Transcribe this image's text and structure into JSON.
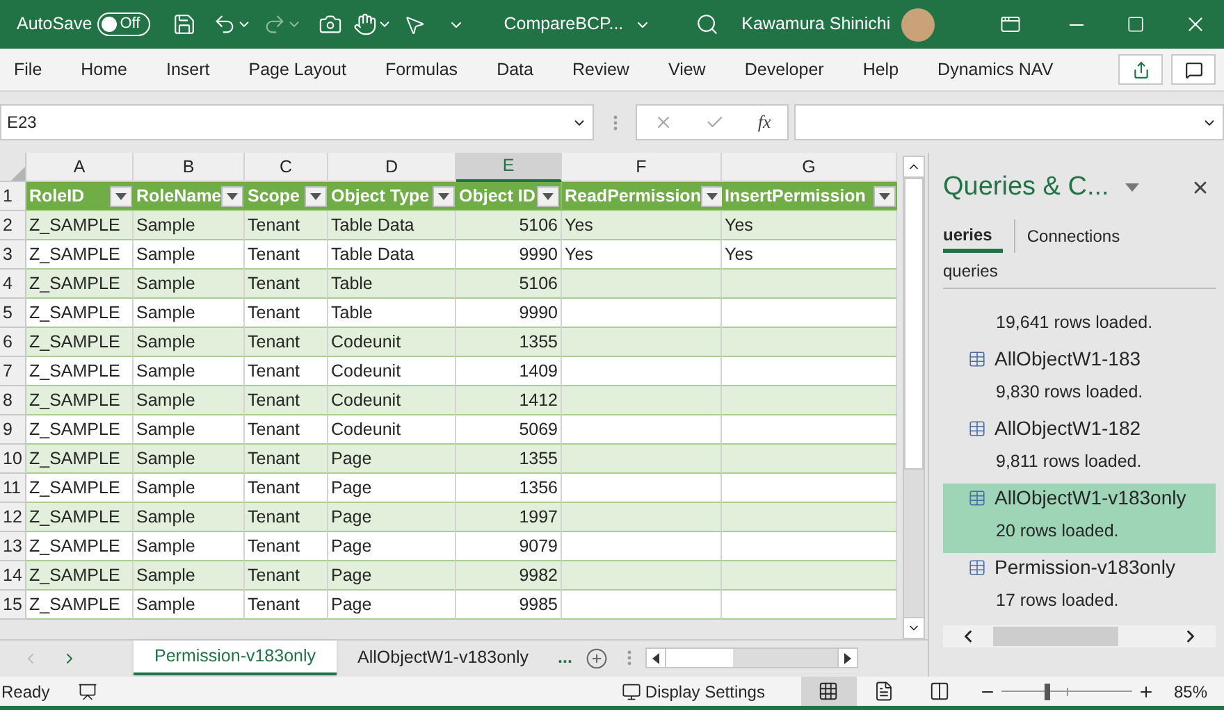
{
  "title_bar": {
    "autosave_label": "AutoSave",
    "autosave_state": "Off",
    "autosave_on": false,
    "document_title": "CompareBCP...",
    "user_name": "Kawamura Shinichi"
  },
  "ribbon_tabs": [
    "File",
    "Home",
    "Insert",
    "Page Layout",
    "Formulas",
    "Data",
    "Review",
    "View",
    "Developer",
    "Help",
    "Dynamics NAV"
  ],
  "formula_bar": {
    "name_box": "E23",
    "function_label": "fx"
  },
  "sheet": {
    "columns": [
      {
        "letter": "A",
        "selected": false
      },
      {
        "letter": "B",
        "selected": false
      },
      {
        "letter": "C",
        "selected": false
      },
      {
        "letter": "D",
        "selected": false
      },
      {
        "letter": "E",
        "selected": true
      },
      {
        "letter": "F",
        "selected": false
      },
      {
        "letter": "G",
        "selected": false
      }
    ],
    "header_row_number": "1",
    "table_headers": [
      {
        "label": "RoleID",
        "numeric": false
      },
      {
        "label": "RoleName",
        "numeric": false
      },
      {
        "label": "Scope",
        "numeric": false
      },
      {
        "label": "Object Type",
        "numeric": false
      },
      {
        "label": "Object ID",
        "numeric": true
      },
      {
        "label": "ReadPermission",
        "numeric": false
      },
      {
        "label": "InsertPermission",
        "numeric": false
      }
    ],
    "rows": [
      {
        "number": "2",
        "cells": [
          "Z_SAMPLE",
          "Sample",
          "Tenant",
          "Table Data",
          "5106",
          "Yes",
          "Yes"
        ]
      },
      {
        "number": "3",
        "cells": [
          "Z_SAMPLE",
          "Sample",
          "Tenant",
          "Table Data",
          "9990",
          "Yes",
          "Yes"
        ]
      },
      {
        "number": "4",
        "cells": [
          "Z_SAMPLE",
          "Sample",
          "Tenant",
          "Table",
          "5106",
          "",
          ""
        ]
      },
      {
        "number": "5",
        "cells": [
          "Z_SAMPLE",
          "Sample",
          "Tenant",
          "Table",
          "9990",
          "",
          ""
        ]
      },
      {
        "number": "6",
        "cells": [
          "Z_SAMPLE",
          "Sample",
          "Tenant",
          "Codeunit",
          "1355",
          "",
          ""
        ]
      },
      {
        "number": "7",
        "cells": [
          "Z_SAMPLE",
          "Sample",
          "Tenant",
          "Codeunit",
          "1409",
          "",
          ""
        ]
      },
      {
        "number": "8",
        "cells": [
          "Z_SAMPLE",
          "Sample",
          "Tenant",
          "Codeunit",
          "1412",
          "",
          ""
        ]
      },
      {
        "number": "9",
        "cells": [
          "Z_SAMPLE",
          "Sample",
          "Tenant",
          "Codeunit",
          "5069",
          "",
          ""
        ]
      },
      {
        "number": "10",
        "cells": [
          "Z_SAMPLE",
          "Sample",
          "Tenant",
          "Page",
          "1355",
          "",
          ""
        ]
      },
      {
        "number": "11",
        "cells": [
          "Z_SAMPLE",
          "Sample",
          "Tenant",
          "Page",
          "1356",
          "",
          ""
        ]
      },
      {
        "number": "12",
        "cells": [
          "Z_SAMPLE",
          "Sample",
          "Tenant",
          "Page",
          "1997",
          "",
          ""
        ]
      },
      {
        "number": "13",
        "cells": [
          "Z_SAMPLE",
          "Sample",
          "Tenant",
          "Page",
          "9079",
          "",
          ""
        ]
      },
      {
        "number": "14",
        "cells": [
          "Z_SAMPLE",
          "Sample",
          "Tenant",
          "Page",
          "9982",
          "",
          ""
        ]
      },
      {
        "number": "15",
        "cells": [
          "Z_SAMPLE",
          "Sample",
          "Tenant",
          "Page",
          "9985",
          "",
          ""
        ]
      }
    ]
  },
  "pane": {
    "title": "Queries & C...",
    "tabs": [
      {
        "label": "ueries",
        "selected": true
      },
      {
        "label": "Connections",
        "selected": false
      }
    ],
    "group_label": "queries",
    "items": [
      {
        "status": "19,641 rows loaded.",
        "selected": false
      },
      {
        "name": "AllObjectW1-183",
        "status": "9,830 rows loaded.",
        "selected": false
      },
      {
        "name": "AllObjectW1-182",
        "status": "9,811 rows loaded.",
        "selected": false
      },
      {
        "name": "AllObjectW1-v183only",
        "status": "20 rows loaded.",
        "selected": true
      },
      {
        "name": "Permission-v183only",
        "status": "17 rows loaded.",
        "selected": false
      }
    ]
  },
  "sheet_tabs": [
    {
      "label": "Permission-v183only",
      "selected": true
    },
    {
      "label": "AllObjectW1-v183only",
      "selected": false
    }
  ],
  "sheet_tabs_more": "...",
  "status_bar": {
    "ready": "Ready",
    "display_settings": "Display Settings",
    "views": [
      {
        "kind": "normal",
        "selected": true
      },
      {
        "kind": "page_layout",
        "selected": false
      },
      {
        "kind": "page_break",
        "selected": false
      }
    ],
    "zoom": {
      "level": 0.35,
      "reading": "85%"
    }
  }
}
